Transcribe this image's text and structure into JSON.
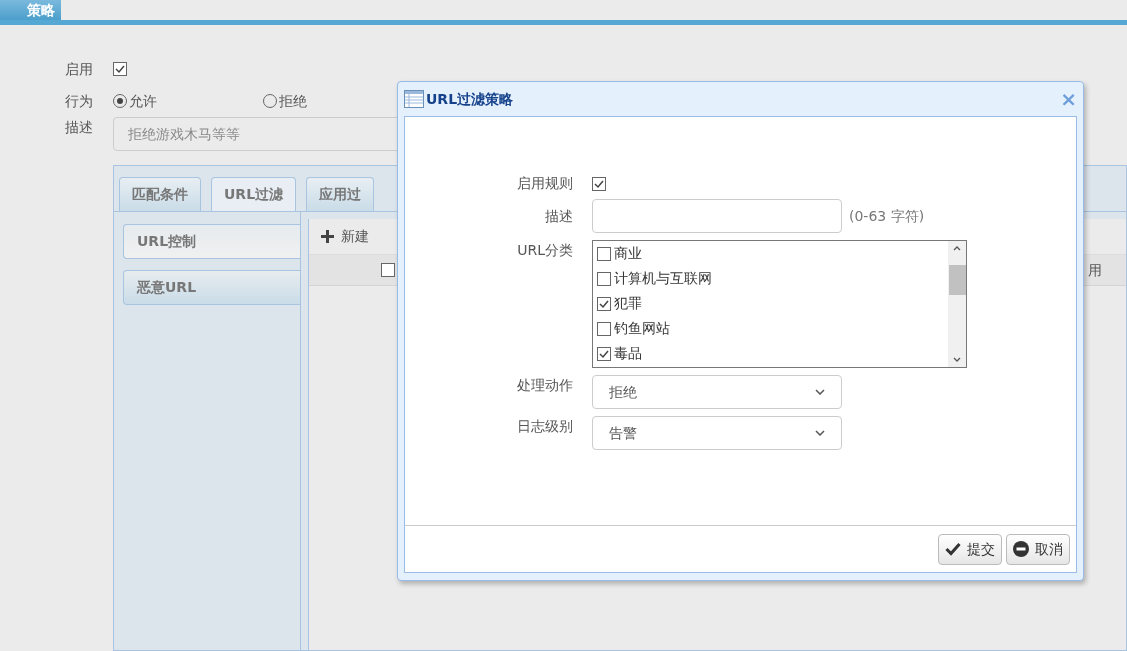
{
  "page_tab": {
    "label": "策略",
    "selected": true
  },
  "form": {
    "enable": {
      "label": "启用",
      "checked": true
    },
    "action": {
      "label": "行为",
      "options": [
        {
          "label": "允许",
          "selected": true
        },
        {
          "label": "拒绝",
          "selected": false
        }
      ]
    },
    "description": {
      "label": "描述",
      "placeholder": "拒绝游戏木马等等"
    }
  },
  "tabs": [
    {
      "label": "匹配条件",
      "selected": false
    },
    {
      "label": "URL过滤",
      "selected": true
    },
    {
      "label": "应用过",
      "selected": false
    }
  ],
  "side_items": [
    {
      "label": "URL控制",
      "selected": true
    },
    {
      "label": "恶意URL",
      "selected": false
    }
  ],
  "toolbar": {
    "new_label": "新建"
  },
  "table": {
    "header_checked": false,
    "column_3": "用"
  },
  "dialog": {
    "title": "URL过滤策略",
    "close": "×",
    "enable_rule": {
      "label": "启用规则",
      "checked": true
    },
    "description": {
      "label": "描述",
      "hint": "(0-63 字符)"
    },
    "categories": {
      "label": "URL分类",
      "items": [
        {
          "label": "商业",
          "checked": false
        },
        {
          "label": "计算机与互联网",
          "checked": false
        },
        {
          "label": "犯罪",
          "checked": true
        },
        {
          "label": "钓鱼网站",
          "checked": false
        },
        {
          "label": "毒品",
          "checked": true
        }
      ]
    },
    "action": {
      "label": "处理动作",
      "value": "拒绝"
    },
    "log_level": {
      "label": "日志级别",
      "value": "告警"
    },
    "buttons": [
      {
        "label": "提交",
        "kind": "submit"
      },
      {
        "label": "取消",
        "kind": "cancel"
      }
    ]
  }
}
